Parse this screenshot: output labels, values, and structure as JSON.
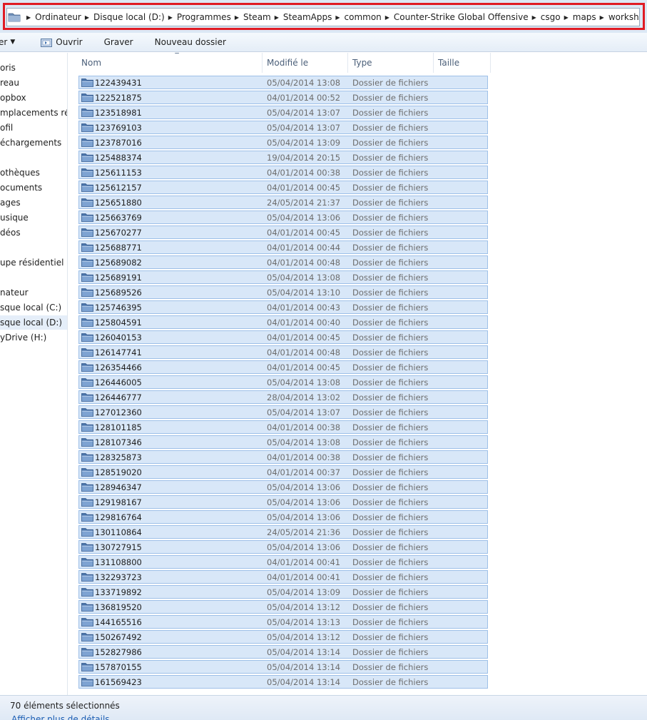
{
  "address_bar": {
    "crumbs": [
      "Ordinateur",
      "Disque local (D:)",
      "Programmes",
      "Steam",
      "SteamApps",
      "common",
      "Counter-Strike Global Offensive",
      "csgo",
      "maps",
      "workshop"
    ]
  },
  "toolbar": {
    "first_label": "er",
    "open_label": "Ouvrir",
    "burn_label": "Graver",
    "new_folder_label": "Nouveau dossier"
  },
  "nav": {
    "items": [
      "oris",
      "reau",
      "opbox",
      "mplacements récer",
      "ofil",
      "échargements",
      "othèques",
      "ocuments",
      "ages",
      "usique",
      "déos",
      "upe résidentiel",
      "nateur",
      "sque local (C:)",
      "sque local (D:)",
      "yDrive (H:)"
    ]
  },
  "columns": {
    "name": "Nom",
    "modified": "Modifié le",
    "type": "Type",
    "size": "Taille"
  },
  "rows": [
    {
      "name": "122439431",
      "date": "05/04/2014 13:08",
      "type": "Dossier de fichiers"
    },
    {
      "name": "122521875",
      "date": "04/01/2014 00:52",
      "type": "Dossier de fichiers"
    },
    {
      "name": "123518981",
      "date": "05/04/2014 13:07",
      "type": "Dossier de fichiers"
    },
    {
      "name": "123769103",
      "date": "05/04/2014 13:07",
      "type": "Dossier de fichiers"
    },
    {
      "name": "123787016",
      "date": "05/04/2014 13:09",
      "type": "Dossier de fichiers"
    },
    {
      "name": "125488374",
      "date": "19/04/2014 20:15",
      "type": "Dossier de fichiers"
    },
    {
      "name": "125611153",
      "date": "04/01/2014 00:38",
      "type": "Dossier de fichiers"
    },
    {
      "name": "125612157",
      "date": "04/01/2014 00:45",
      "type": "Dossier de fichiers"
    },
    {
      "name": "125651880",
      "date": "24/05/2014 21:37",
      "type": "Dossier de fichiers"
    },
    {
      "name": "125663769",
      "date": "05/04/2014 13:06",
      "type": "Dossier de fichiers"
    },
    {
      "name": "125670277",
      "date": "04/01/2014 00:45",
      "type": "Dossier de fichiers"
    },
    {
      "name": "125688771",
      "date": "04/01/2014 00:44",
      "type": "Dossier de fichiers"
    },
    {
      "name": "125689082",
      "date": "04/01/2014 00:48",
      "type": "Dossier de fichiers"
    },
    {
      "name": "125689191",
      "date": "05/04/2014 13:08",
      "type": "Dossier de fichiers"
    },
    {
      "name": "125689526",
      "date": "05/04/2014 13:10",
      "type": "Dossier de fichiers"
    },
    {
      "name": "125746395",
      "date": "04/01/2014 00:43",
      "type": "Dossier de fichiers"
    },
    {
      "name": "125804591",
      "date": "04/01/2014 00:40",
      "type": "Dossier de fichiers"
    },
    {
      "name": "126040153",
      "date": "04/01/2014 00:45",
      "type": "Dossier de fichiers"
    },
    {
      "name": "126147741",
      "date": "04/01/2014 00:48",
      "type": "Dossier de fichiers"
    },
    {
      "name": "126354466",
      "date": "04/01/2014 00:45",
      "type": "Dossier de fichiers"
    },
    {
      "name": "126446005",
      "date": "05/04/2014 13:08",
      "type": "Dossier de fichiers"
    },
    {
      "name": "126446777",
      "date": "28/04/2014 13:02",
      "type": "Dossier de fichiers"
    },
    {
      "name": "127012360",
      "date": "05/04/2014 13:07",
      "type": "Dossier de fichiers"
    },
    {
      "name": "128101185",
      "date": "04/01/2014 00:38",
      "type": "Dossier de fichiers"
    },
    {
      "name": "128107346",
      "date": "05/04/2014 13:08",
      "type": "Dossier de fichiers"
    },
    {
      "name": "128325873",
      "date": "04/01/2014 00:38",
      "type": "Dossier de fichiers"
    },
    {
      "name": "128519020",
      "date": "04/01/2014 00:37",
      "type": "Dossier de fichiers"
    },
    {
      "name": "128946347",
      "date": "05/04/2014 13:06",
      "type": "Dossier de fichiers"
    },
    {
      "name": "129198167",
      "date": "05/04/2014 13:06",
      "type": "Dossier de fichiers"
    },
    {
      "name": "129816764",
      "date": "05/04/2014 13:06",
      "type": "Dossier de fichiers"
    },
    {
      "name": "130110864",
      "date": "24/05/2014 21:36",
      "type": "Dossier de fichiers"
    },
    {
      "name": "130727915",
      "date": "05/04/2014 13:06",
      "type": "Dossier de fichiers"
    },
    {
      "name": "131108800",
      "date": "04/01/2014 00:41",
      "type": "Dossier de fichiers"
    },
    {
      "name": "132293723",
      "date": "04/01/2014 00:41",
      "type": "Dossier de fichiers"
    },
    {
      "name": "133719892",
      "date": "05/04/2014 13:09",
      "type": "Dossier de fichiers"
    },
    {
      "name": "136819520",
      "date": "05/04/2014 13:12",
      "type": "Dossier de fichiers"
    },
    {
      "name": "144165516",
      "date": "05/04/2014 13:13",
      "type": "Dossier de fichiers"
    },
    {
      "name": "150267492",
      "date": "05/04/2014 13:12",
      "type": "Dossier de fichiers"
    },
    {
      "name": "152827986",
      "date": "05/04/2014 13:14",
      "type": "Dossier de fichiers"
    },
    {
      "name": "157870155",
      "date": "05/04/2014 13:14",
      "type": "Dossier de fichiers"
    },
    {
      "name": "161569423",
      "date": "05/04/2014 13:14",
      "type": "Dossier de fichiers"
    }
  ],
  "status": {
    "count_text": "70 éléments sélectionnés",
    "details_link": "Afficher plus de détails"
  },
  "colors": {
    "highlight_border": "#e01b24",
    "row_selected_bg": "#d8e7f8",
    "row_selected_border": "#9ec0e8",
    "link": "#1a5db3"
  }
}
